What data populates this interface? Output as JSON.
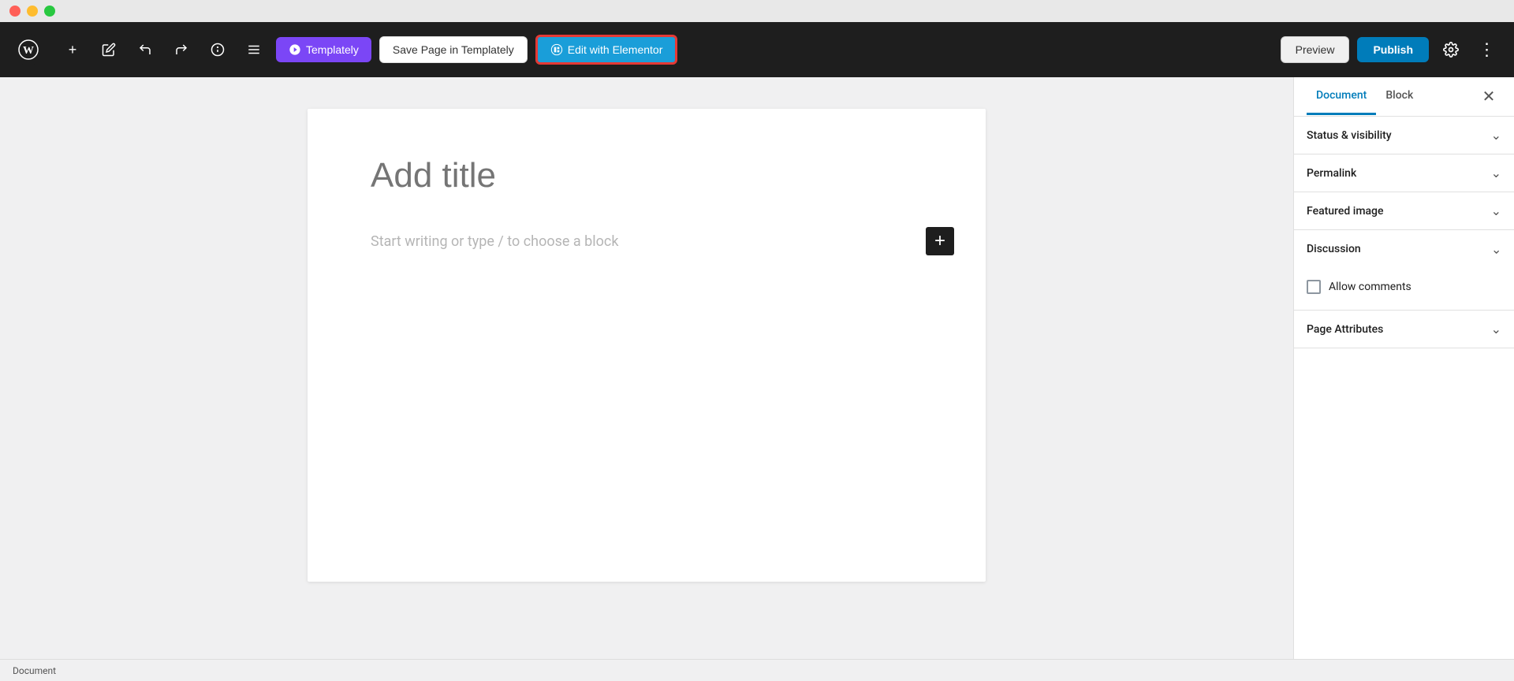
{
  "titlebar": {
    "close_label": "",
    "minimize_label": "",
    "maximize_label": ""
  },
  "toolbar": {
    "add_label": "+",
    "pen_label": "✏",
    "undo_label": "↩",
    "redo_label": "↪",
    "info_label": "ℹ",
    "menu_label": "☰",
    "templately_label": "Templately",
    "save_templately_label": "Save Page in Templately",
    "edit_elementor_label": "Edit with Elementor",
    "preview_label": "Preview",
    "publish_label": "Publish",
    "settings_label": "⚙",
    "more_label": "⋮"
  },
  "editor": {
    "title_placeholder": "Add title",
    "body_placeholder": "Start writing or type / to choose a block",
    "add_block_label": "+"
  },
  "sidebar": {
    "tab_document": "Document",
    "tab_block": "Block",
    "close_label": "✕",
    "panels": [
      {
        "id": "status-visibility",
        "title": "Status & visibility",
        "expanded": false,
        "chevron": "∨"
      },
      {
        "id": "permalink",
        "title": "Permalink",
        "expanded": false,
        "chevron": "∨"
      },
      {
        "id": "featured-image",
        "title": "Featured image",
        "expanded": false,
        "chevron": "∨"
      },
      {
        "id": "discussion",
        "title": "Discussion",
        "expanded": true,
        "chevron": "∧"
      },
      {
        "id": "page-attributes",
        "title": "Page Attributes",
        "expanded": false,
        "chevron": "∨"
      }
    ],
    "discussion": {
      "allow_comments_label": "Allow comments"
    }
  },
  "statusbar": {
    "document_label": "Document"
  },
  "colors": {
    "accent_blue": "#007cba",
    "toolbar_bg": "#1e1e1e",
    "elementor_red": "#e53935",
    "templately_purple": "#7b46f6"
  }
}
